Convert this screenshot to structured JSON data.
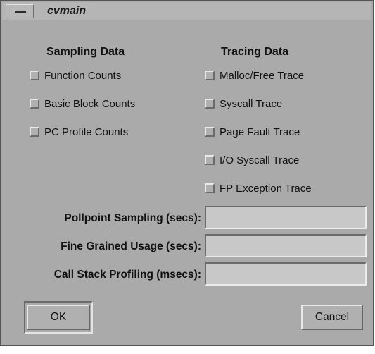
{
  "window": {
    "title": "cvmain"
  },
  "sampling": {
    "header": "Sampling Data",
    "options": [
      {
        "label": "Function Counts",
        "checked": false
      },
      {
        "label": "Basic Block Counts",
        "checked": false
      },
      {
        "label": "PC Profile Counts",
        "checked": false
      }
    ]
  },
  "tracing": {
    "header": "Tracing Data",
    "options": [
      {
        "label": "Malloc/Free Trace",
        "checked": false
      },
      {
        "label": "Syscall Trace",
        "checked": false
      },
      {
        "label": "Page Fault Trace",
        "checked": false
      },
      {
        "label": "I/O Syscall Trace",
        "checked": false
      },
      {
        "label": "FP Exception Trace",
        "checked": false
      }
    ]
  },
  "fields": [
    {
      "label": "Pollpoint Sampling (secs):",
      "value": ""
    },
    {
      "label": "Fine Grained Usage (secs):",
      "value": ""
    },
    {
      "label": "Call Stack Profiling (msecs):",
      "value": ""
    }
  ],
  "buttons": {
    "ok": "OK",
    "cancel": "Cancel"
  },
  "colors": {
    "background": "#aaaaaa",
    "title_bar": "#b5b5b5",
    "field_background": "#c8c8c8"
  },
  "icons": {
    "window_menu": "window-menu-icon"
  }
}
